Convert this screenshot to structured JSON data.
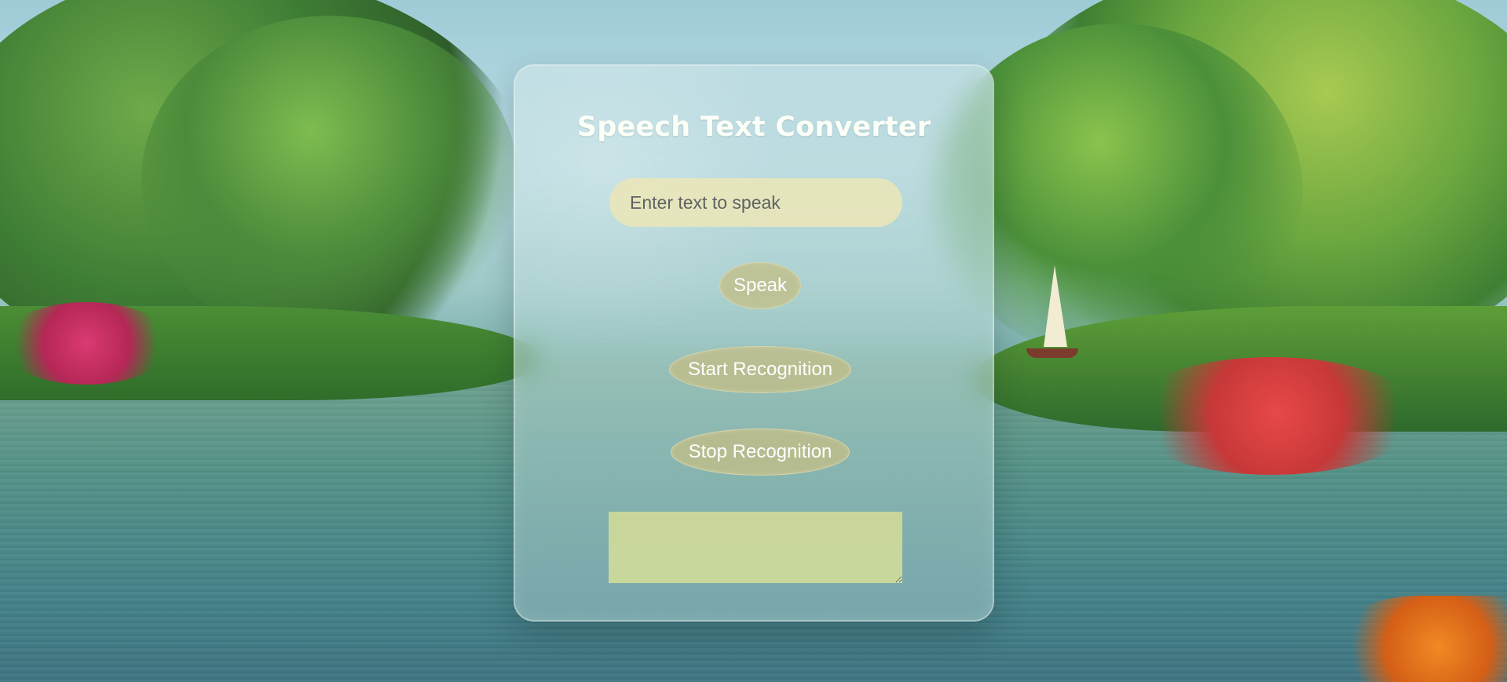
{
  "app": {
    "title": "Speech Text Converter"
  },
  "input": {
    "placeholder": "Enter text to speak",
    "value": ""
  },
  "buttons": {
    "speak": "Speak",
    "start_recognition": "Start Recognition",
    "stop_recognition": "Stop Recognition"
  },
  "result": {
    "value": ""
  },
  "colors": {
    "title_text": "#fbfff7",
    "input_background": "#ebe6b8",
    "button_background": "#c3be86",
    "textarea_background": "#ccd89b"
  }
}
